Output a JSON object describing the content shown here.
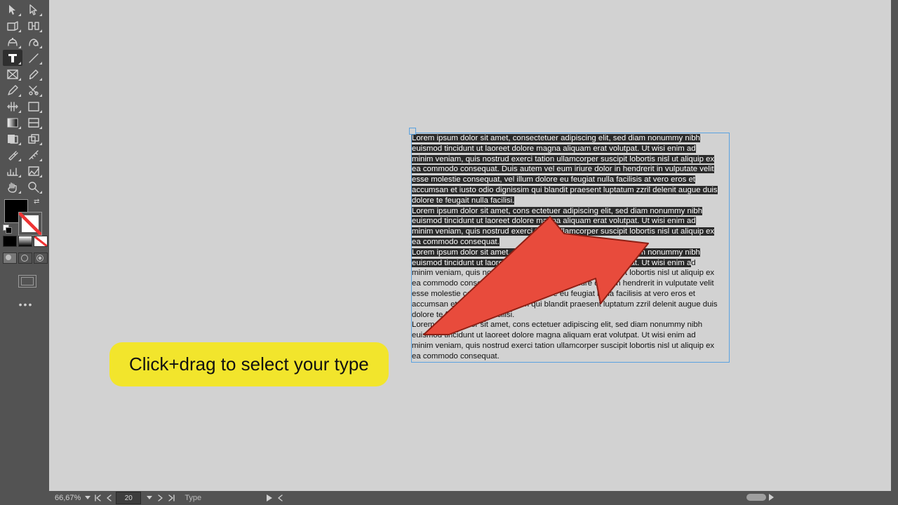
{
  "tools": {
    "row": [
      "selection",
      "direct-selection",
      "page",
      "gap",
      "content-collector",
      "content-placer",
      "type",
      "line",
      "rectangle-frame",
      "pen",
      "pencil",
      "scissors",
      "free-transform",
      "rectangle",
      "gradient-swatch",
      "gradient-feather",
      "note",
      "transform-again",
      "eyedropper",
      "measure",
      "gradient",
      "column-guides",
      "hand",
      "zoom"
    ],
    "selected": "type"
  },
  "fillstroke": {
    "fill": "#000000",
    "stroke": "none"
  },
  "paragraphs": [
    {
      "lines": [
        "Lorem ipsum dolor sit amet, consectetuer adipiscing elit, sed diam nonummy nibh",
        "euismod tincidunt ut laoreet dolore magna aliquam erat volutpat. Ut wisi enim ad",
        "minim veniam, quis nostrud exerci tation ullamcorper suscipit lobortis nisl ut aliquip ex",
        "ea commodo consequat. Duis autem vel eum iriure dolor in hendrerit in vulputate velit",
        "esse molestie consequat, vel illum dolore eu feugiat nulla facilisis at vero eros et",
        "accumsan et iusto odio dignissim qui blandit praesent luptatum zzril delenit augue duis",
        "dolore te feugait nulla facilisi."
      ],
      "fullHighlight": true
    },
    {
      "lines": [
        "Lorem ipsum dolor sit amet, cons ectetuer adipiscing elit, sed diam nonummy nibh",
        "euismod tincidunt ut laoreet dolore magna aliquam erat volutpat. Ut wisi enim ad",
        "minim veniam, quis nostrud exerci tation ullamcorper suscipit lobortis nisl ut aliquip ex",
        "ea commodo consequat."
      ],
      "fullHighlight": true
    },
    {
      "lines": [
        {
          "hl": "Lorem ipsum dolor sit amet, consectetuer adipiscing elit, sed diam nonummy nibh",
          "plain": ""
        },
        {
          "hl": "euismod tincidunt ut laoreet dolore magna aliquam erat volutpat. Ut wisi enim a",
          "plain": "d"
        },
        {
          "hl": "",
          "plain": "minim veniam, quis nostrud exerci tation ullamcorper suscipit lobortis nisl ut aliquip ex"
        },
        {
          "hl": "",
          "plain": "ea commodo consequat. Duis autem vel eum iriure dolor in hendrerit in vulputate velit"
        },
        {
          "hl": "",
          "plain": "esse molestie consequat, vel illum dolore eu feugiat nulla facilisis at vero eros et"
        },
        {
          "hl": "",
          "plain": "accumsan et iusto odio dignissim qui blandit praesent luptatum zzril delenit augue duis"
        },
        {
          "hl": "",
          "plain": "dolore te feugait nulla facilisi."
        }
      ],
      "fullHighlight": false
    },
    {
      "lines": [
        "Lorem ipsum dolor sit amet, cons ectetuer adipiscing elit, sed diam nonummy nibh",
        "euismod tincidunt ut laoreet dolore magna aliquam erat volutpat. Ut wisi enim ad",
        "minim veniam, quis nostrud exerci tation ullamcorper suscipit lobortis nisl ut aliquip ex",
        "ea commodo consequat."
      ],
      "fullHighlight": false
    }
  ],
  "annotation": {
    "bubble": "Click+drag to select your type"
  },
  "status": {
    "zoom": "66,67%",
    "page": "20",
    "mode": "Type"
  }
}
